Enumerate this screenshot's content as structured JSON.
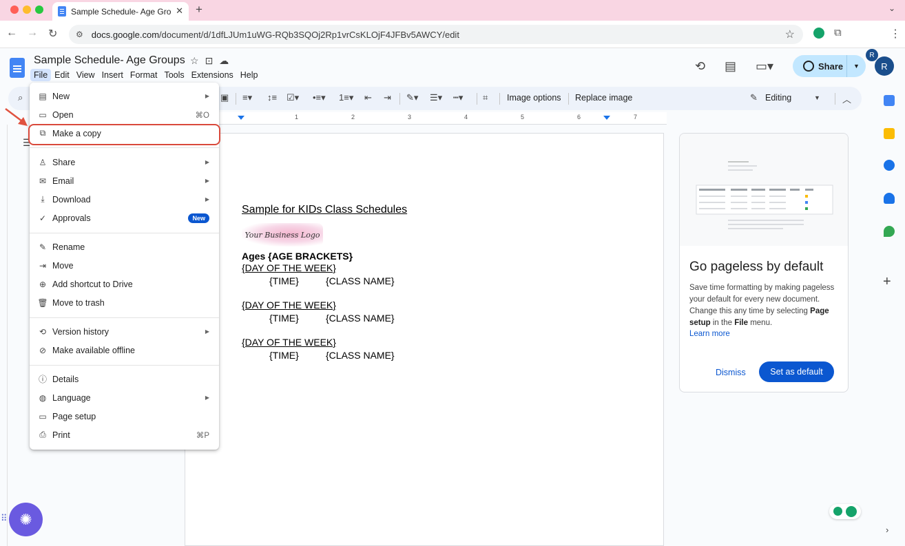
{
  "browser": {
    "tab_title": "Sample Schedule- Age Groups",
    "close_glyph": "✕",
    "newtab_glyph": "+",
    "url_domain": "docs.google.com",
    "url_path": "/document/d/1dfLJUm1uWG-RQb3SQOj2Rp1vrCsKLOjF4JFBv5AWCY/edit",
    "avatar_letter": "R",
    "colors": {
      "tab_strip": "#f9d6e3",
      "close": "#ff5f57",
      "minimize": "#febc2e",
      "maximize": "#28c840"
    }
  },
  "docs": {
    "title": "Sample Schedule- Age Groups",
    "menu": [
      "File",
      "Edit",
      "View",
      "Insert",
      "Format",
      "Tools",
      "Extensions",
      "Help"
    ],
    "share_label": "Share",
    "avatar_letter": "R",
    "accent": "#0b57d0"
  },
  "toolbar": {
    "image_options": "Image options",
    "replace_image": "Replace image",
    "editing": "Editing"
  },
  "ruler": {
    "numbers": [
      "1",
      "2",
      "3",
      "4",
      "5",
      "6",
      "7"
    ]
  },
  "file_menu": {
    "items": [
      {
        "label": "New",
        "icon": "doc-icon",
        "submenu": true
      },
      {
        "label": "Open",
        "icon": "folder-icon",
        "shortcut": "⌘O"
      },
      {
        "label": "Make a copy",
        "icon": "copy-icon"
      },
      {
        "label": "Share",
        "icon": "person-add-icon",
        "submenu": true
      },
      {
        "label": "Email",
        "icon": "email-icon",
        "submenu": true
      },
      {
        "label": "Download",
        "icon": "download-icon",
        "submenu": true
      },
      {
        "label": "Approvals",
        "icon": "approval-icon",
        "badge": "New"
      },
      {
        "label": "Rename",
        "icon": "rename-icon"
      },
      {
        "label": "Move",
        "icon": "move-icon"
      },
      {
        "label": "Add shortcut to Drive",
        "icon": "shortcut-icon"
      },
      {
        "label": "Move to trash",
        "icon": "trash-icon"
      },
      {
        "label": "Version history",
        "icon": "history-icon",
        "submenu": true
      },
      {
        "label": "Make available offline",
        "icon": "offline-icon"
      },
      {
        "label": "Details",
        "icon": "info-icon"
      },
      {
        "label": "Language",
        "icon": "globe-icon",
        "submenu": true
      },
      {
        "label": "Page setup",
        "icon": "page-setup-icon"
      },
      {
        "label": "Print",
        "icon": "print-icon",
        "shortcut": "⌘P"
      }
    ],
    "highlight_color": "#d9493b"
  },
  "document": {
    "heading": "Sample for KIDs Class Schedules",
    "logo_text": "Your Business Logo",
    "ages": "Ages {AGE BRACKETS}",
    "blocks": [
      {
        "day": "{DAY OF THE WEEK}",
        "time": "{TIME}",
        "class": "{CLASS NAME}"
      },
      {
        "day": "{DAY OF THE WEEK}",
        "time": "{TIME}",
        "class": "{CLASS NAME}"
      },
      {
        "day": "{DAY OF THE WEEK}",
        "time": "{TIME}",
        "class": "{CLASS NAME}"
      }
    ]
  },
  "pageless_card": {
    "title": "Go pageless by default",
    "body_pre": "Save time formatting by making pageless your default for every new document. Change this any time by selecting ",
    "body_bold1": "Page setup",
    "body_mid": " in the ",
    "body_bold2": "File",
    "body_post": " menu.",
    "learn_more": "Learn more",
    "dismiss": "Dismiss",
    "set_default": "Set as default"
  }
}
